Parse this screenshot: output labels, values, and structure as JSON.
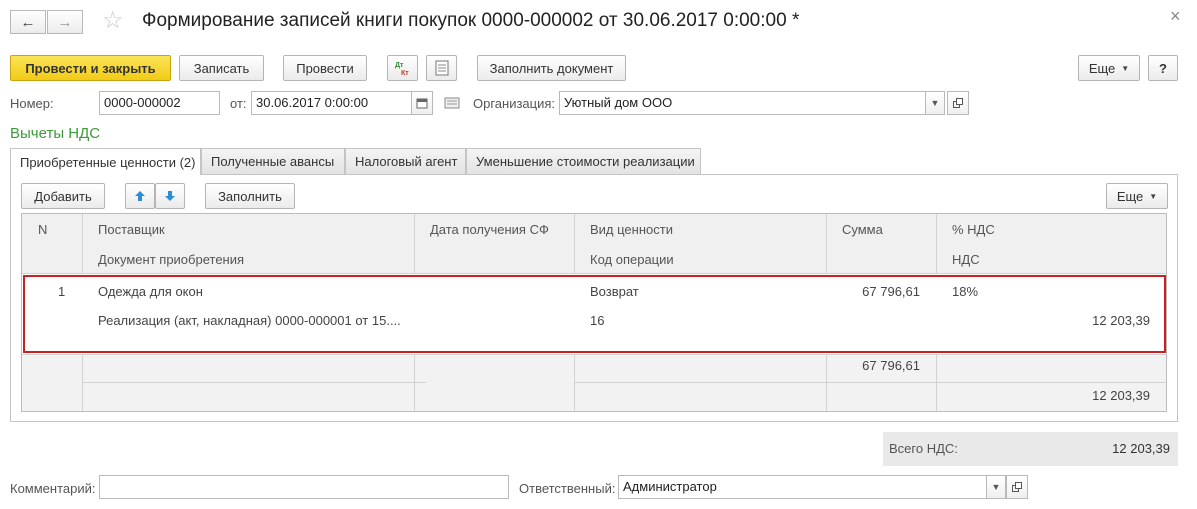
{
  "window": {
    "title": "Формирование записей книги покупок 0000-000002 от 30.06.2017 0:00:00 *",
    "back_icon": "←",
    "forward_icon": "→",
    "star_icon": "☆",
    "close_icon": "×"
  },
  "toolbar": {
    "post_close": "Провести и закрыть",
    "save": "Записать",
    "post": "Провести",
    "dt_kt": "Дт Кт",
    "fill_doc": "Заполнить документ",
    "more": "Еще",
    "help": "?"
  },
  "form": {
    "number_label": "Номер:",
    "number_value": "0000-000002",
    "date_label": "от:",
    "date_value": "30.06.2017  0:00:00",
    "org_label": "Организация:",
    "org_value": "Уютный дом ООО"
  },
  "section_title": "Вычеты НДС",
  "tabs": [
    {
      "label": "Приобретенные ценности (2)"
    },
    {
      "label": "Полученные авансы"
    },
    {
      "label": "Налоговый агент"
    },
    {
      "label": "Уменьшение стоимости реализации"
    }
  ],
  "table_toolbar": {
    "add": "Добавить",
    "up_icon": "arrow-up",
    "down_icon": "arrow-down",
    "fill": "Заполнить",
    "more": "Еще"
  },
  "table": {
    "headers": {
      "n": "N",
      "supplier": "Поставщик",
      "doc": "Документ приобретения",
      "date_sf": "Дата получения СФ",
      "value_type": "Вид ценности",
      "op_code": "Код операции",
      "sum": "Сумма",
      "vat_pct": "% НДС",
      "vat": "НДС"
    },
    "rows": [
      {
        "n": "1",
        "supplier": "Одежда для окон",
        "doc": "Реализация (акт, накладная) 0000-000001 от 15....",
        "value_type": "Возврат",
        "op_code": "16",
        "sum": "67 796,61",
        "vat_pct": "18%",
        "vat": "12 203,39"
      }
    ],
    "totals": {
      "sum": "67 796,61",
      "vat": "12 203,39"
    }
  },
  "total_vat": {
    "label": "Всего НДС:",
    "value": "12 203,39"
  },
  "bottom": {
    "comment_label": "Комментарий:",
    "comment_value": "",
    "responsible_label": "Ответственный:",
    "responsible_value": "Администратор"
  },
  "colors": {
    "primary_button": "#f2cb16",
    "section_title": "#3c9a3c",
    "highlight_frame": "#cc1f1f",
    "arrow_buttons": "#2c8fd6"
  }
}
